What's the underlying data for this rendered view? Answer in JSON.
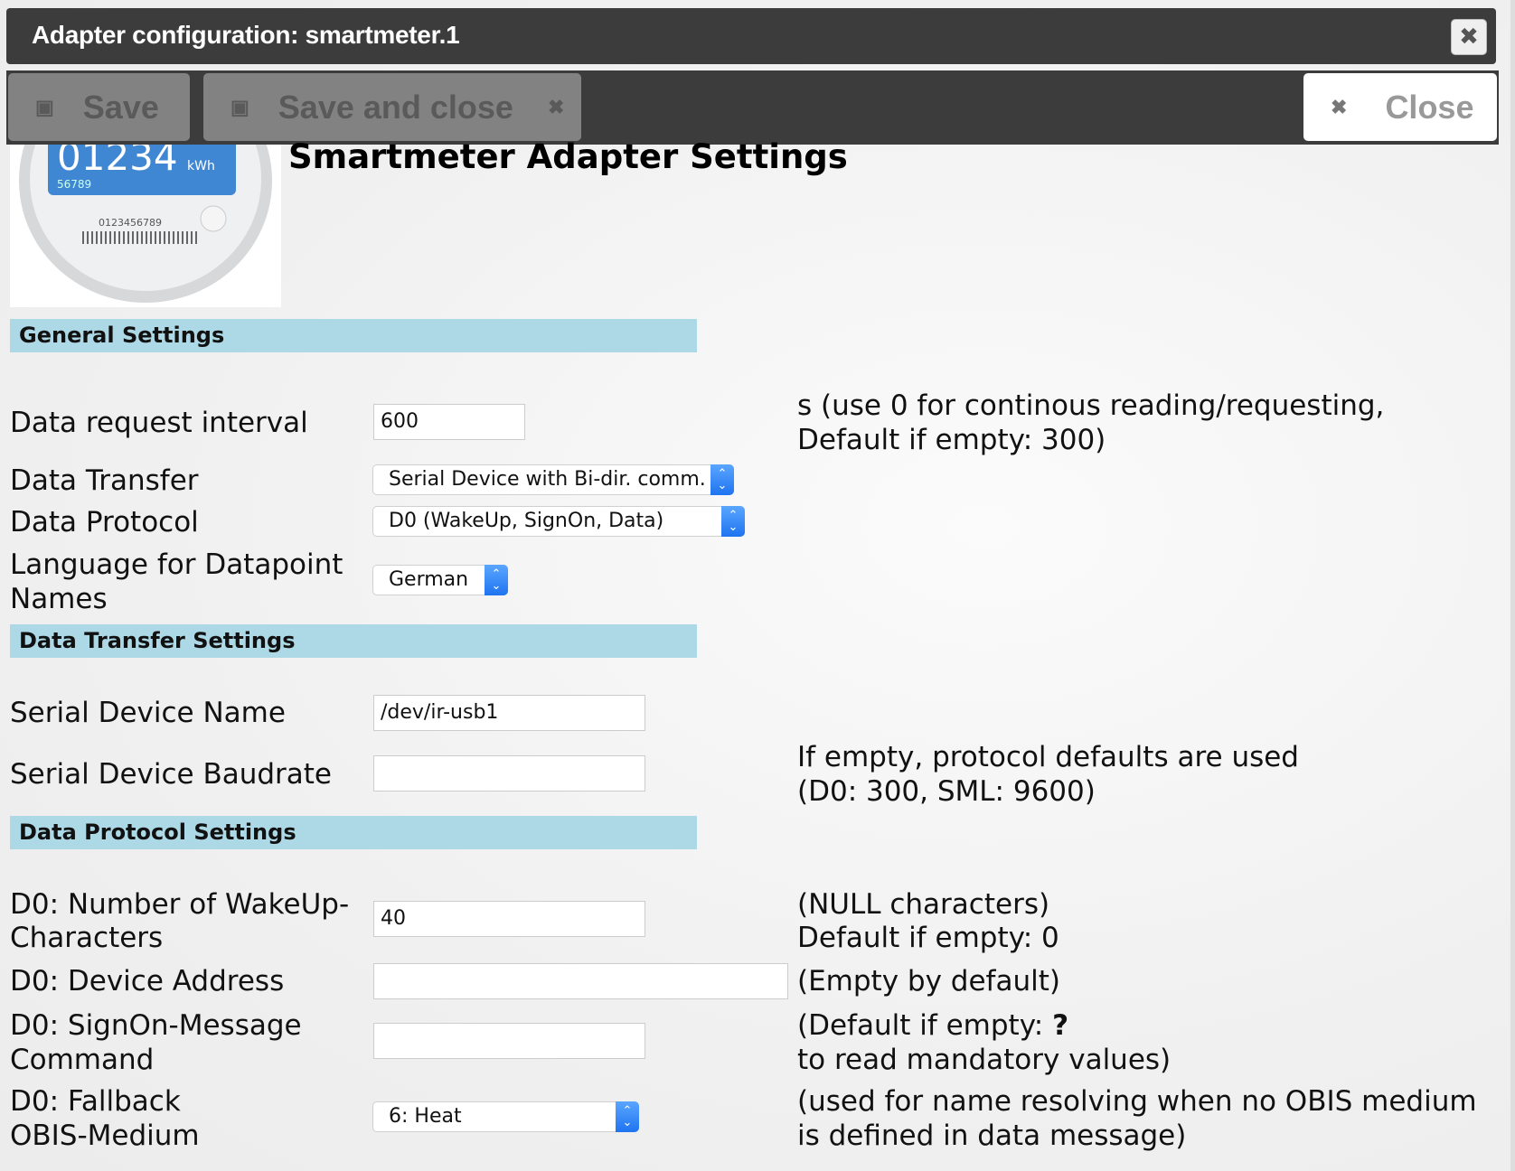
{
  "window": {
    "title": "Adapter configuration: smartmeter.1",
    "close_icon": "close-icon"
  },
  "toolbar": {
    "save_label": "Save",
    "save_close_label": "Save and close",
    "close_label": "Close"
  },
  "page": {
    "heading": "Smartmeter Adapter Settings",
    "logo": {
      "reading": "01234",
      "unit": "kWh",
      "sub": "56789",
      "serial": "0123456789"
    }
  },
  "sections": {
    "general": "General Settings",
    "transfer": "Data Transfer Settings",
    "protocol": "Data Protocol Settings"
  },
  "fields": {
    "interval": {
      "label": "Data request interval",
      "value": "600",
      "note1": "s (use 0 for continous reading/requesting,",
      "note2": "Default if empty: 300)"
    },
    "transfer": {
      "label": "Data Transfer",
      "value": "Serial Device with Bi-dir. comm."
    },
    "protocol": {
      "label": "Data Protocol",
      "value": "D0 (WakeUp, SignOn, Data)"
    },
    "language": {
      "label1": "Language for Datapoint",
      "label2": "Names",
      "value": "German"
    },
    "serial_name": {
      "label": "Serial Device Name",
      "value": "/dev/ir-usb1"
    },
    "baudrate": {
      "label": "Serial Device Baudrate",
      "value": "",
      "note1": "If empty, protocol defaults are used",
      "note2": "(D0: 300, SML: 9600)"
    },
    "wakeup": {
      "label1": "D0: Number of WakeUp-",
      "label2": "Characters",
      "value": "40",
      "note1": "(NULL characters)",
      "note2": "Default if empty: 0"
    },
    "address": {
      "label": "D0: Device Address",
      "value": "",
      "note": "(Empty by default)"
    },
    "signon": {
      "label1": "D0: SignOn-Message",
      "label2": "Command",
      "value": "",
      "note1a": "(Default if empty: ",
      "note1b": "?",
      "note2": "to read mandatory values)"
    },
    "medium": {
      "label1": "D0: Fallback",
      "label2": "OBIS-Medium",
      "value": "6: Heat",
      "note1": "(used for name resolving when no OBIS medium",
      "note2": "is defined in data message)"
    }
  },
  "colors": {
    "section_bg": "#add8e6",
    "titlebar": "#3c3c3c",
    "select_arrow": "#2a7ef5"
  }
}
